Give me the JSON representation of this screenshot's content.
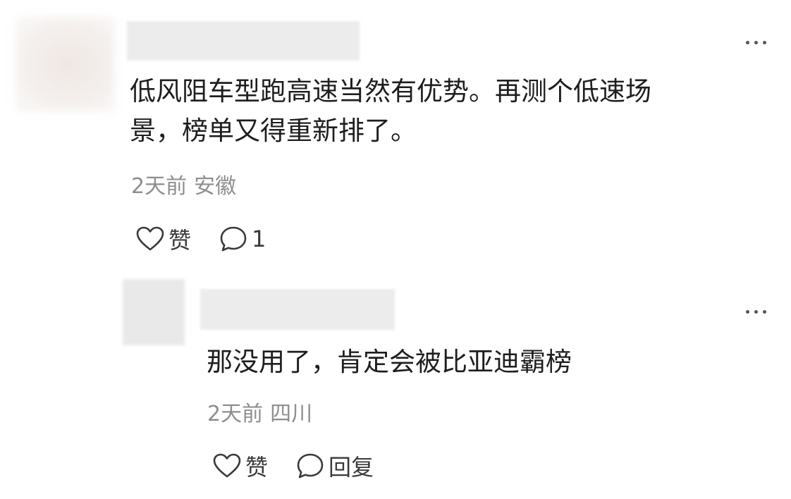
{
  "comment": {
    "text_line1": "低风阻车型跑高速当然有优势。再测个低速场",
    "text_line2": "景，榜单又得重新排了。",
    "time": "2天前",
    "location": "安徽",
    "like_label": "赞",
    "reply_count": "1",
    "more_icon": "more-horizontal-icon"
  },
  "reply": {
    "text": "那没用了，肯定会被比亚迪霸榜",
    "time": "2天前",
    "location": "四川",
    "like_label": "赞",
    "reply_label": "回复",
    "more_icon": "more-horizontal-icon"
  },
  "colors": {
    "text": "#1e1e1e",
    "meta": "#8e8e8e",
    "icon": "#3a3a3a"
  }
}
